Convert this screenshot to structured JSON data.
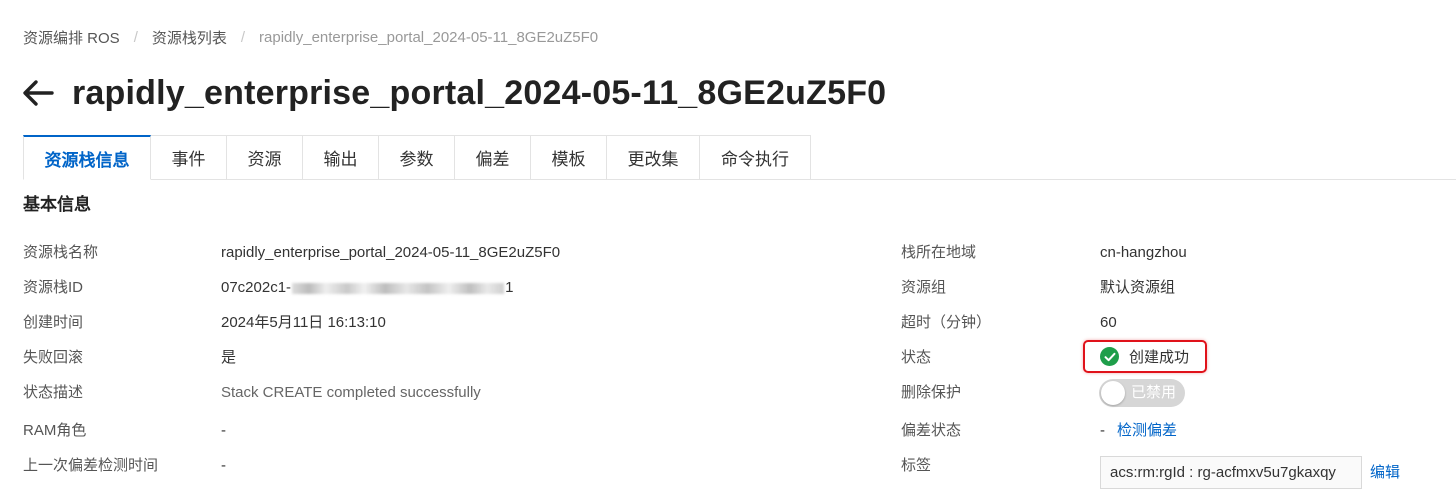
{
  "breadcrumb": {
    "items": [
      "资源编排 ROS",
      "资源栈列表"
    ],
    "current": "rapidly_enterprise_portal_2024-05-11_8GE2uZ5F0",
    "separator": "/"
  },
  "page": {
    "title": "rapidly_enterprise_portal_2024-05-11_8GE2uZ5F0"
  },
  "tabs": [
    {
      "label": "资源栈信息",
      "active": true
    },
    {
      "label": "事件"
    },
    {
      "label": "资源"
    },
    {
      "label": "输出"
    },
    {
      "label": "参数"
    },
    {
      "label": "偏差"
    },
    {
      "label": "模板"
    },
    {
      "label": "更改集"
    },
    {
      "label": "命令执行"
    }
  ],
  "section": {
    "title": "基本信息"
  },
  "left": {
    "stack_name": {
      "label": "资源栈名称",
      "value": "rapidly_enterprise_portal_2024-05-11_8GE2uZ5F0"
    },
    "stack_id": {
      "label": "资源栈ID",
      "value_prefix": "07c202c1-",
      "value_suffix": "1"
    },
    "created": {
      "label": "创建时间",
      "value": "2024年5月11日 16:13:10"
    },
    "rollback": {
      "label": "失败回滚",
      "value": "是"
    },
    "status_desc": {
      "label": "状态描述",
      "value": "Stack CREATE completed successfully"
    },
    "ram_role": {
      "label": "RAM角色",
      "value": "-"
    },
    "last_drift": {
      "label": "上一次偏差检测时间",
      "value": "-"
    }
  },
  "right": {
    "region": {
      "label": "栈所在地域",
      "value": "cn-hangzhou"
    },
    "resource_group": {
      "label": "资源组",
      "value": "默认资源组"
    },
    "timeout": {
      "label": "超时（分钟）",
      "value": "60"
    },
    "status": {
      "label": "状态",
      "value": "创建成功"
    },
    "delete_protection": {
      "label": "删除保护",
      "value": "已禁用",
      "enabled": false
    },
    "drift_status": {
      "label": "偏差状态",
      "value": "-",
      "action": "检测偏差"
    },
    "tags": {
      "label": "标签",
      "value": "acs:rm:rgId : rg-acfmxv5u7gkaxqy",
      "action": "编辑"
    }
  },
  "colors": {
    "primary": "#0064c8",
    "success": "#1e9e4a",
    "highlight": "#e0121a",
    "toggle_off": "#d6d6d6"
  },
  "icons": {
    "back": "arrow-left-icon",
    "status": "check-circle-icon"
  }
}
